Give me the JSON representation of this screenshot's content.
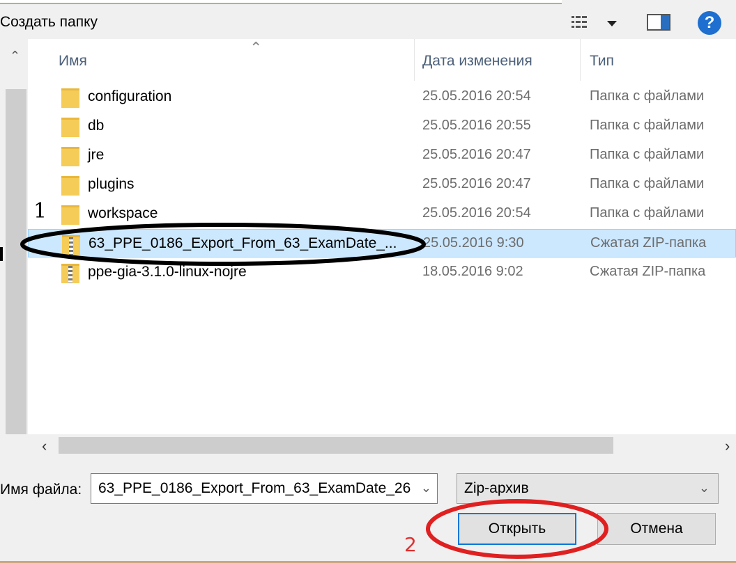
{
  "toolbar": {
    "new_folder_label": "Создать папку",
    "help_label": "?"
  },
  "columns": {
    "name": "Имя",
    "date": "Дата изменения",
    "type": "Тип"
  },
  "files": [
    {
      "name": "configuration",
      "date": "25.05.2016 20:54",
      "type": "Папка с файлами",
      "icon": "folder-icon"
    },
    {
      "name": "db",
      "date": "25.05.2016 20:55",
      "type": "Папка с файлами",
      "icon": "folder-icon"
    },
    {
      "name": "jre",
      "date": "25.05.2016 20:47",
      "type": "Папка с файлами",
      "icon": "folder-icon"
    },
    {
      "name": "plugins",
      "date": "25.05.2016 20:47",
      "type": "Папка с файлами",
      "icon": "folder-icon"
    },
    {
      "name": "workspace",
      "date": "25.05.2016 20:54",
      "type": "Папка с файлами",
      "icon": "folder-icon"
    },
    {
      "name": "63_PPE_0186_Export_From_63_ExamDate_...",
      "date": "25.05.2016 9:30",
      "type": "Сжатая ZIP-папка",
      "icon": "zip-icon",
      "selected": true
    },
    {
      "name": "ppe-gia-3.1.0-linux-nojre",
      "date": "18.05.2016 9:02",
      "type": "Сжатая ZIP-папка",
      "icon": "zip-icon"
    }
  ],
  "bottom": {
    "filename_label": "Имя файла:",
    "filename_value": "63_PPE_0186_Export_From_63_ExamDate_26",
    "filetype_value": "Zip-архив",
    "open_label": "Открыть",
    "cancel_label": "Отмена"
  },
  "annotations": {
    "step1": "1",
    "step2": "2",
    "ellipse_color": "#e02020"
  }
}
